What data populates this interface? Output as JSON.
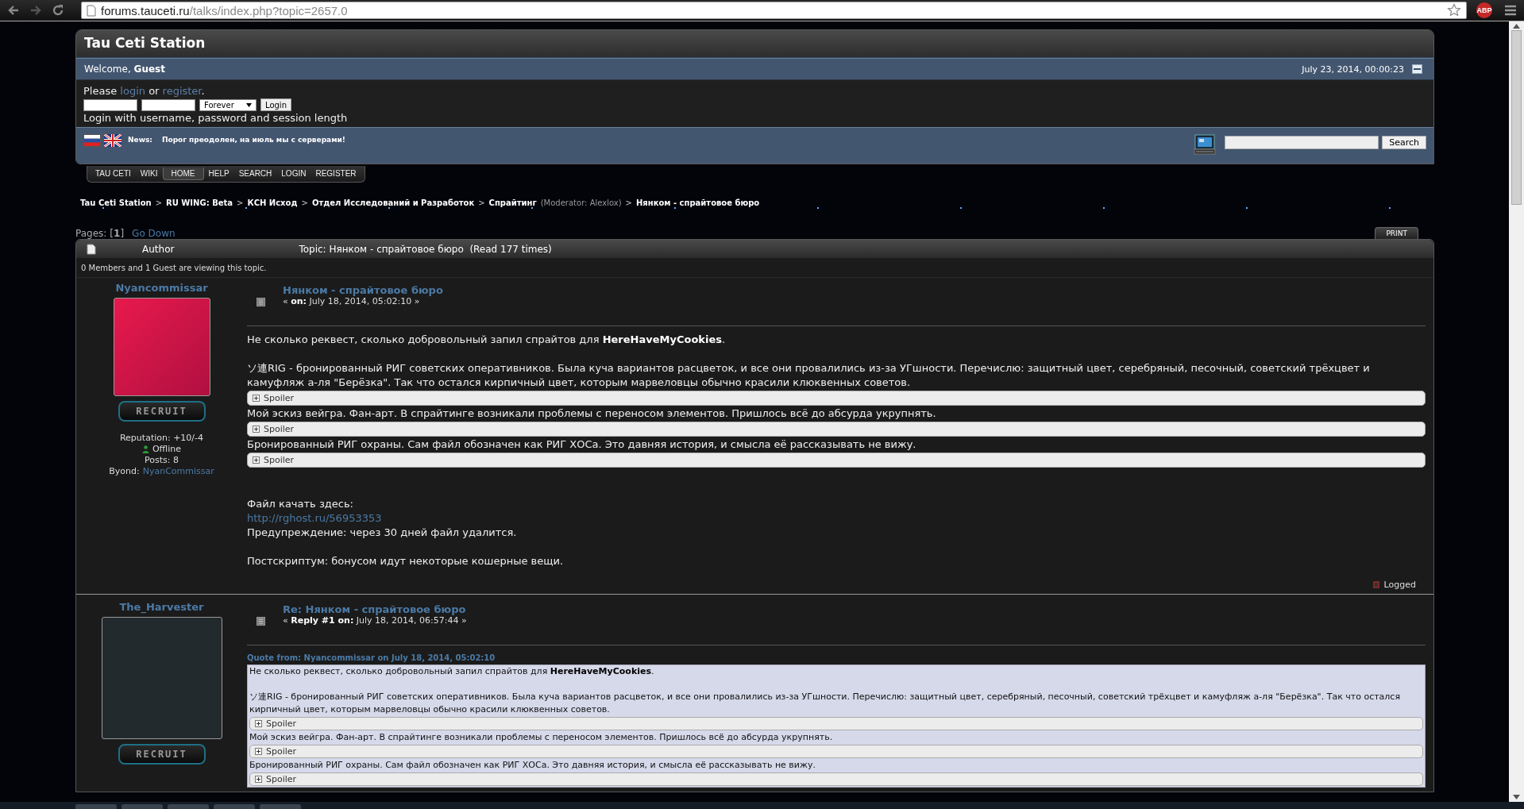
{
  "browser": {
    "url_host": "forums.tauceti.ru",
    "url_path": "/talks/index.php?topic=2657.0",
    "extension_badge": "ABP"
  },
  "header": {
    "title": "Tau Ceti Station",
    "welcome": "Welcome, **Guest**",
    "date": "July 23, 2014, 00:00:23"
  },
  "login": {
    "prompt": "Please",
    "login_link": "login",
    "middle": "or",
    "register_link": "register",
    "end": ".",
    "duration": "Forever",
    "button": "Login",
    "hint": "Login with username, password and session length"
  },
  "news": {
    "label": "News:",
    "text": "Порог преодолен, на июль мы с серверами!",
    "search_button": "Search"
  },
  "menu": [
    {
      "label": "TAU CETI",
      "selected": false
    },
    {
      "label": "WIKI",
      "selected": false
    },
    {
      "label": "HOME",
      "selected": true
    },
    {
      "label": "HELP",
      "selected": false
    },
    {
      "label": "SEARCH",
      "selected": false
    },
    {
      "label": "LOGIN",
      "selected": false
    },
    {
      "label": "REGISTER",
      "selected": false
    }
  ],
  "breadcrumb": {
    "separator": ">",
    "items": [
      {
        "label": "Tau Ceti Station"
      },
      {
        "label": "RU WING: Beta"
      },
      {
        "label": "КСН Исход"
      },
      {
        "label": "Отдел Исследований и Разработок"
      },
      {
        "label": "Спрайтинг",
        "note": "(Moderator: Alexlox)"
      },
      {
        "label": "Нянком - спрайтовое бюро"
      }
    ]
  },
  "pages": {
    "label": "Pages:",
    "current": "[**1**]",
    "go_down": "Go Down",
    "print": "PRINT"
  },
  "topic_header": {
    "author": "Author",
    "topic": "Topic: Нянком - спрайтовое бюро  (Read 177 times)"
  },
  "viewing": "0 Members and 1 Guest are viewing this topic.",
  "posts": [
    {
      "author": "Nyancommissar",
      "rank": "RECRUIT",
      "stats": [
        {
          "kind": "text",
          "text": "Reputation: +10/-4"
        },
        {
          "kind": "status",
          "text": "Offline"
        },
        {
          "kind": "text",
          "text": "Posts: 8"
        },
        {
          "kind": "link",
          "label": "Byond:",
          "text": "NyanCommissar"
        }
      ],
      "title": "Нянком - спрайтовое бюро",
      "meta": "« **on:** July 18, 2014, 05:02:10 »",
      "body": [
        {
          "kind": "text",
          "text": "Не сколько реквест, сколько добровольный запил спрайтов для **HereHaveMyCookies**."
        },
        {
          "kind": "gap"
        },
        {
          "kind": "text",
          "text": "ソ連RIG - бронированный РИГ советских оперативников. Была куча вариантов расцветок, и все они провалились из-за УГшности. Перечислю: защитный цвет, серебряный, песочный, советский трёхцвет и камуфляж а-ля \"Берёзка\". Так что остался кирпичный цвет, которым марвеловцы обычно красили клюквенных советов."
        },
        {
          "kind": "spoiler",
          "text": "Spoiler"
        },
        {
          "kind": "text",
          "text": "Мой эскиз вейгра. Фан-арт. В спрайтинге возникали проблемы с переносом элементов. Пришлось всё до абсурда укрупнять."
        },
        {
          "kind": "spoiler",
          "text": "Spoiler"
        },
        {
          "kind": "text",
          "text": "Бронированный РИГ охраны. Сам файл обозначен как РИГ ХОСа. Это давняя история, и смысла её рассказывать не вижу."
        },
        {
          "kind": "spoiler",
          "text": "Spoiler"
        },
        {
          "kind": "gap"
        },
        {
          "kind": "gap"
        },
        {
          "kind": "text",
          "text": "Файл качать здесь:"
        },
        {
          "kind": "link",
          "text": "http://rghost.ru/56953353"
        },
        {
          "kind": "text",
          "text": "Предупреждение: через 30 дней файл удалится."
        },
        {
          "kind": "gap"
        },
        {
          "kind": "text",
          "text": "Постскриптум: бонусом идут некоторые кошерные вещи."
        }
      ],
      "footer": "Logged"
    },
    {
      "author": "The_Harvester",
      "rank": "RECRUIT",
      "title": "Re: Нянком - спрайтовое бюро",
      "meta": "« **Reply #1 on:** July 18, 2014, 06:57:44 »",
      "quote": {
        "header": "Quote from: Nyancommissar on July 18, 2014, 05:02:10",
        "body": [
          {
            "kind": "text",
            "text": "Не сколько реквест, сколько добровольный запил спрайтов для **HereHaveMyCookies**."
          },
          {
            "kind": "gap"
          },
          {
            "kind": "text",
            "text": "ソ連RIG - бронированный РИГ советских оперативников. Была куча вариантов расцветок, и все они провалились из-за УГшности. Перечислю: защитный цвет, серебряный, песочный, советский трёхцвет и камуфляж а-ля \"Берёзка\". Так что остался кирпичный цвет, которым марвеловцы обычно красили клюквенных советов."
          },
          {
            "kind": "spoiler",
            "text": "Spoiler"
          },
          {
            "kind": "text",
            "text": "Мой эскиз вейгра. Фан-арт. В спрайтинге возникали проблемы с переносом элементов. Пришлось всё до абсурда укрупнять."
          },
          {
            "kind": "spoiler",
            "text": "Spoiler"
          },
          {
            "kind": "text",
            "text": "Бронированный РИГ охраны. Сам файл обозначен как РИГ ХОСа. Это давняя история, и смысла её рассказывать не вижу."
          },
          {
            "kind": "spoiler",
            "text": "Spoiler"
          }
        ]
      }
    }
  ]
}
